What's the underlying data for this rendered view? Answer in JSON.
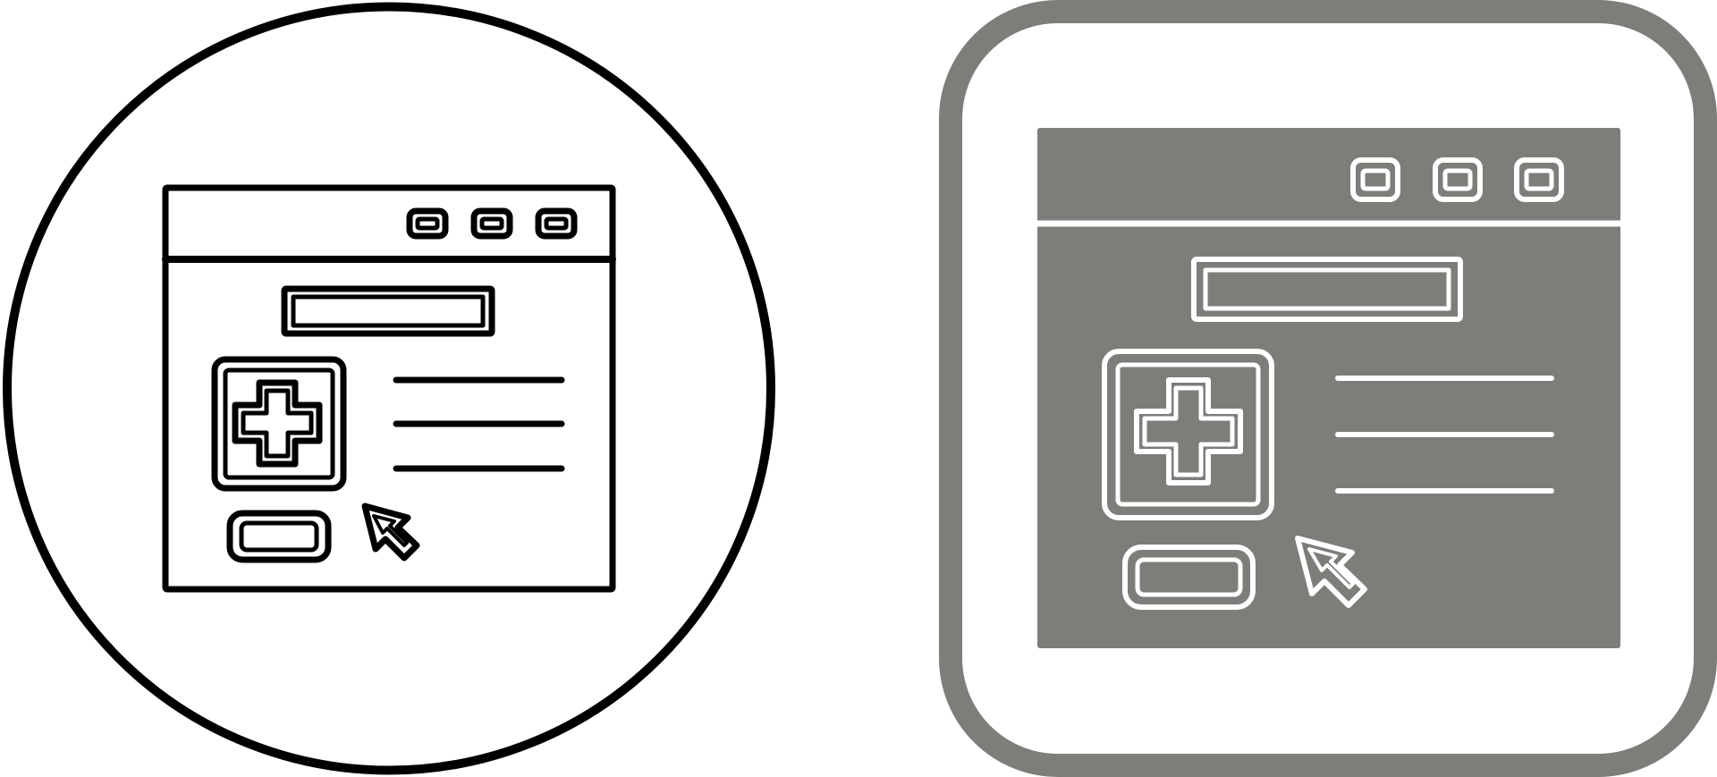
{
  "icons": [
    {
      "name": "medical-website-outline-icon",
      "style": "outline",
      "stroke_color": "#000000",
      "fill_color": "#ffffff"
    },
    {
      "name": "medical-website-filled-icon",
      "style": "filled",
      "stroke_color": "#ffffff",
      "fill_color": "#7d7d79",
      "frame_color": "#7d7d79"
    }
  ]
}
